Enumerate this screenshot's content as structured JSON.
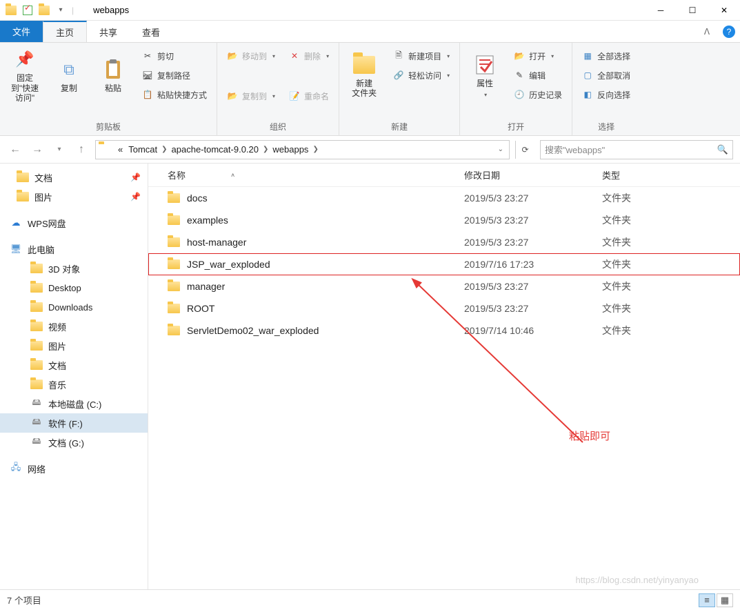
{
  "window": {
    "title": "webapps"
  },
  "tabs": {
    "file": "文件",
    "home": "主页",
    "share": "共享",
    "view": "查看"
  },
  "ribbon": {
    "clipboard": {
      "label": "剪贴板",
      "pin": "固定到\"快速访问\"",
      "copy": "复制",
      "paste": "粘贴",
      "cut": "剪切",
      "copy_path": "复制路径",
      "paste_shortcut": "粘贴快捷方式"
    },
    "organize": {
      "label": "组织",
      "move_to": "移动到",
      "copy_to": "复制到",
      "delete": "删除",
      "rename": "重命名"
    },
    "new": {
      "label": "新建",
      "new_folder": "新建\n文件夹",
      "new_item": "新建项目",
      "easy_access": "轻松访问"
    },
    "open": {
      "label": "打开",
      "properties": "属性",
      "open": "打开",
      "edit": "编辑",
      "history": "历史记录"
    },
    "select": {
      "label": "选择",
      "select_all": "全部选择",
      "select_none": "全部取消",
      "invert": "反向选择"
    }
  },
  "breadcrumb": {
    "items": [
      "Tomcat",
      "apache-tomcat-9.0.20",
      "webapps"
    ],
    "search_placeholder": "搜索\"webapps\""
  },
  "tree": {
    "documents": "文档",
    "pictures": "图片",
    "wps": "WPS网盘",
    "this_pc": "此电脑",
    "objects3d": "3D 对象",
    "desktop": "Desktop",
    "downloads": "Downloads",
    "videos": "视频",
    "pictures2": "图片",
    "documents2": "文档",
    "music": "音乐",
    "local_c": "本地磁盘 (C:)",
    "soft_f": "软件 (F:)",
    "doc_g": "文档 (G:)",
    "network": "网络"
  },
  "columns": {
    "name": "名称",
    "date": "修改日期",
    "type": "类型"
  },
  "files": [
    {
      "name": "docs",
      "date": "2019/5/3 23:27",
      "type": "文件夹"
    },
    {
      "name": "examples",
      "date": "2019/5/3 23:27",
      "type": "文件夹"
    },
    {
      "name": "host-manager",
      "date": "2019/5/3 23:27",
      "type": "文件夹"
    },
    {
      "name": "JSP_war_exploded",
      "date": "2019/7/16 17:23",
      "type": "文件夹",
      "highlighted": true
    },
    {
      "name": "manager",
      "date": "2019/5/3 23:27",
      "type": "文件夹"
    },
    {
      "name": "ROOT",
      "date": "2019/5/3 23:27",
      "type": "文件夹"
    },
    {
      "name": "ServletDemo02_war_exploded",
      "date": "2019/7/14 10:46",
      "type": "文件夹"
    }
  ],
  "annotation": "粘贴即可",
  "status": {
    "count": "7 个项目"
  },
  "watermark": "https://blog.csdn.net/yinyanyao"
}
